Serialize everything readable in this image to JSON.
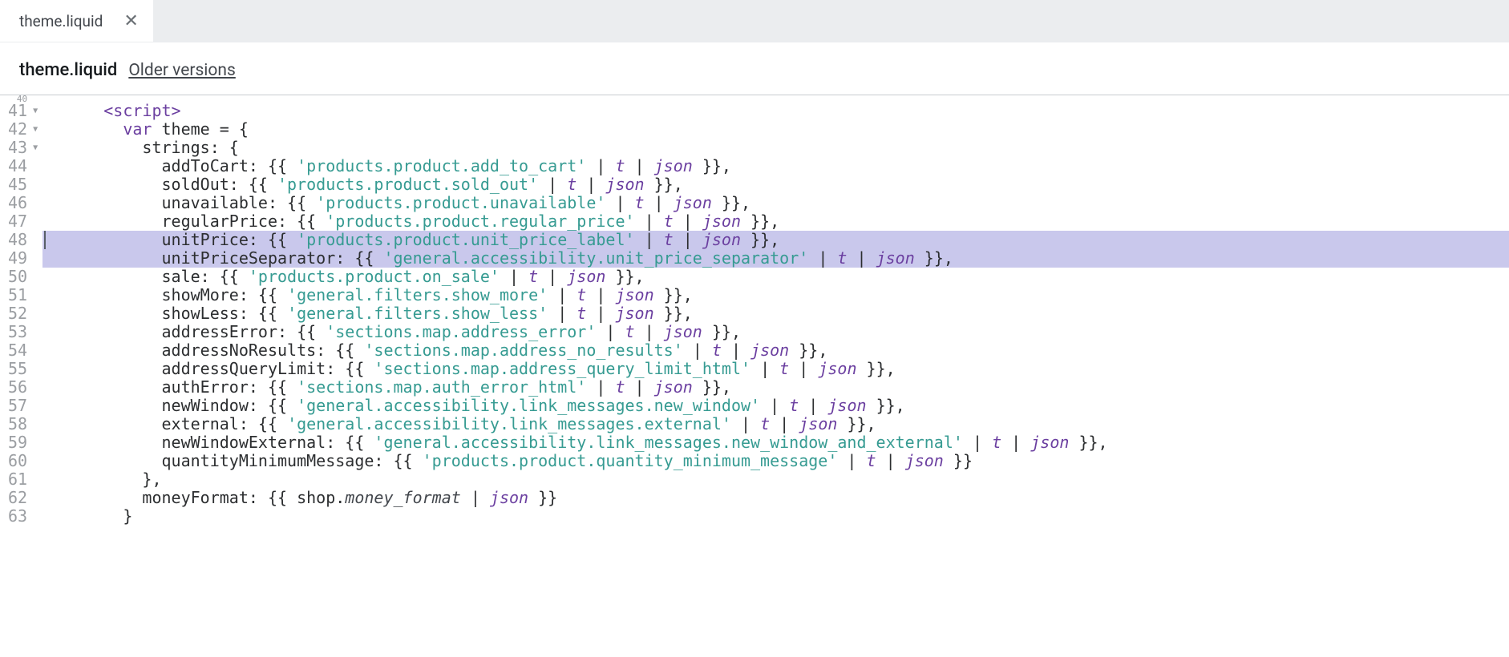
{
  "tab": {
    "name": "theme.liquid",
    "close_glyph": "✕"
  },
  "path": {
    "filename": "theme.liquid",
    "older_versions": "Older versions"
  },
  "gutter": {
    "top_partial": "40",
    "lines": [
      {
        "n": "41",
        "fold": true
      },
      {
        "n": "42",
        "fold": true
      },
      {
        "n": "43",
        "fold": true
      },
      {
        "n": "44",
        "fold": false
      },
      {
        "n": "45",
        "fold": false
      },
      {
        "n": "46",
        "fold": false
      },
      {
        "n": "47",
        "fold": false
      },
      {
        "n": "48",
        "fold": false
      },
      {
        "n": "49",
        "fold": false
      },
      {
        "n": "50",
        "fold": false
      },
      {
        "n": "51",
        "fold": false
      },
      {
        "n": "52",
        "fold": false
      },
      {
        "n": "53",
        "fold": false
      },
      {
        "n": "54",
        "fold": false
      },
      {
        "n": "55",
        "fold": false
      },
      {
        "n": "56",
        "fold": false
      },
      {
        "n": "57",
        "fold": false
      },
      {
        "n": "58",
        "fold": false
      },
      {
        "n": "59",
        "fold": false
      },
      {
        "n": "60",
        "fold": false
      },
      {
        "n": "61",
        "fold": false
      },
      {
        "n": "62",
        "fold": false
      },
      {
        "n": "63",
        "fold": false
      }
    ]
  },
  "highlighted_lines": [
    48,
    49
  ],
  "code": {
    "i1": "    ",
    "i2": "      ",
    "i3": "        ",
    "i4": "          ",
    "tag_script_open": "<script>",
    "kw_var": "var",
    "decl": " theme = {",
    "strings_open": "strings: {",
    "props": [
      {
        "key": "addToCart",
        "str": "'products.product.add_to_cart'",
        "filters": [
          "t",
          "json"
        ],
        "comma": true
      },
      {
        "key": "soldOut",
        "str": "'products.product.sold_out'",
        "filters": [
          "t",
          "json"
        ],
        "comma": true
      },
      {
        "key": "unavailable",
        "str": "'products.product.unavailable'",
        "filters": [
          "t",
          "json"
        ],
        "comma": true
      },
      {
        "key": "regularPrice",
        "str": "'products.product.regular_price'",
        "filters": [
          "t",
          "json"
        ],
        "comma": true
      },
      {
        "key": "unitPrice",
        "str": "'products.product.unit_price_label'",
        "filters": [
          "t",
          "json"
        ],
        "comma": true
      },
      {
        "key": "unitPriceSeparator",
        "str": "'general.accessibility.unit_price_separator'",
        "filters": [
          "t",
          "json"
        ],
        "comma": true
      },
      {
        "key": "sale",
        "str": "'products.product.on_sale'",
        "filters": [
          "t",
          "json"
        ],
        "comma": true
      },
      {
        "key": "showMore",
        "str": "'general.filters.show_more'",
        "filters": [
          "t",
          "json"
        ],
        "comma": true
      },
      {
        "key": "showLess",
        "str": "'general.filters.show_less'",
        "filters": [
          "t",
          "json"
        ],
        "comma": true
      },
      {
        "key": "addressError",
        "str": "'sections.map.address_error'",
        "filters": [
          "t",
          "json"
        ],
        "comma": true
      },
      {
        "key": "addressNoResults",
        "str": "'sections.map.address_no_results'",
        "filters": [
          "t",
          "json"
        ],
        "comma": true
      },
      {
        "key": "addressQueryLimit",
        "str": "'sections.map.address_query_limit_html'",
        "filters": [
          "t",
          "json"
        ],
        "comma": true
      },
      {
        "key": "authError",
        "str": "'sections.map.auth_error_html'",
        "filters": [
          "t",
          "json"
        ],
        "comma": true
      },
      {
        "key": "newWindow",
        "str": "'general.accessibility.link_messages.new_window'",
        "filters": [
          "t",
          "json"
        ],
        "comma": true
      },
      {
        "key": "external",
        "str": "'general.accessibility.link_messages.external'",
        "filters": [
          "t",
          "json"
        ],
        "comma": true
      },
      {
        "key": "newWindowExternal",
        "str": "'general.accessibility.link_messages.new_window_and_external'",
        "filters": [
          "t",
          "json"
        ],
        "comma": true
      },
      {
        "key": "quantityMinimumMessage",
        "str": "'products.product.quantity_minimum_message'",
        "filters": [
          "t",
          "json"
        ],
        "comma": false
      }
    ],
    "strings_close": "},",
    "money_key": "moneyFormat",
    "money_expr_prefix": "shop.",
    "money_expr_field": "money_format",
    "money_filters": [
      "json"
    ],
    "obj_close": "}"
  }
}
